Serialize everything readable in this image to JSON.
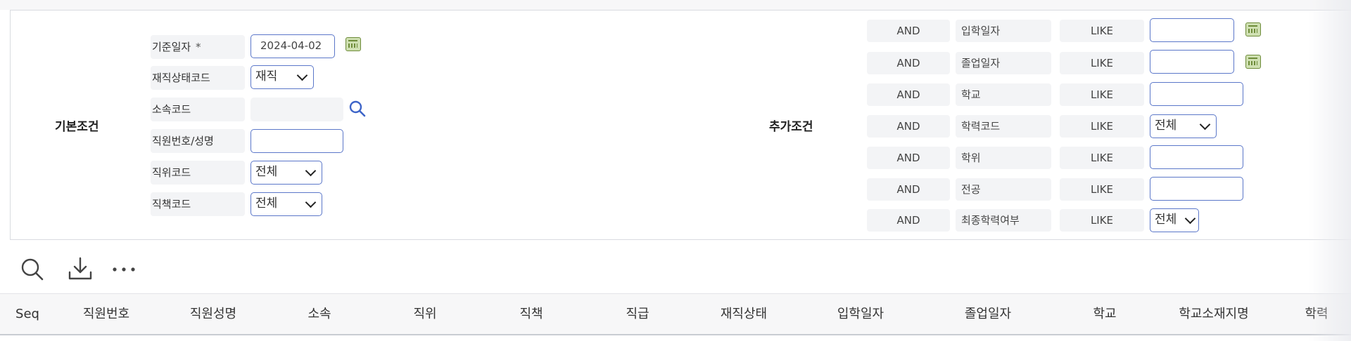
{
  "basic": {
    "title": "기본조건",
    "fields": {
      "base_date": {
        "label": "기준일자",
        "required_mark": "*",
        "value": "2024-04-02"
      },
      "emp_status": {
        "label": "재직상태코드",
        "value": "재직"
      },
      "dept": {
        "label": "소속코드",
        "value": ""
      },
      "emp_no_name": {
        "label": "직원번호/성명",
        "value": ""
      },
      "position": {
        "label": "직위코드",
        "value": "전체"
      },
      "duty": {
        "label": "직책코드",
        "value": "전체"
      }
    }
  },
  "extra": {
    "title": "추가조건",
    "rows": [
      {
        "op": "AND",
        "field": "입학일자",
        "cmp": "LIKE",
        "value": ""
      },
      {
        "op": "AND",
        "field": "졸업일자",
        "cmp": "LIKE",
        "value": ""
      },
      {
        "op": "AND",
        "field": "학교",
        "cmp": "LIKE",
        "value": ""
      },
      {
        "op": "AND",
        "field": "학력코드",
        "cmp": "LIKE",
        "value": "전체"
      },
      {
        "op": "AND",
        "field": "학위",
        "cmp": "LIKE",
        "value": ""
      },
      {
        "op": "AND",
        "field": "전공",
        "cmp": "LIKE",
        "value": ""
      },
      {
        "op": "AND",
        "field": "최종학력여부",
        "cmp": "LIKE",
        "value": "전체"
      }
    ]
  },
  "toolbar": {
    "icons": [
      "search-icon",
      "download-icon",
      "more-icon"
    ]
  },
  "grid": {
    "columns": [
      "Seq",
      "직원번호",
      "직원성명",
      "소속",
      "직위",
      "직책",
      "직급",
      "재직상태",
      "입학일자",
      "졸업일자",
      "학교",
      "학교소재지명",
      "학력"
    ]
  },
  "colors": {
    "input_border": "#5b77c9",
    "label_bg": "#f3f4f6",
    "calendar_green": "#6e8c3a"
  }
}
